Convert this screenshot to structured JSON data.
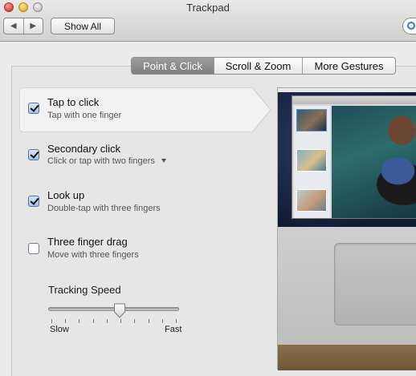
{
  "window": {
    "title": "Trackpad"
  },
  "toolbar": {
    "show_all_label": "Show All",
    "back_glyph": "◀",
    "forward_glyph": "▶"
  },
  "tabs": [
    {
      "label": "Point & Click",
      "active": true
    },
    {
      "label": "Scroll & Zoom",
      "active": false
    },
    {
      "label": "More Gestures",
      "active": false
    }
  ],
  "options": [
    {
      "label": "Tap to click",
      "sublabel": "Tap with one finger",
      "checked": true,
      "selected": true
    },
    {
      "label": "Secondary click",
      "sublabel": "Click or tap with two fingers",
      "checked": true,
      "has_dropdown": true
    },
    {
      "label": "Look up",
      "sublabel": "Double-tap with three fingers",
      "checked": true
    },
    {
      "label": "Three finger drag",
      "sublabel": "Move with three fingers",
      "checked": false
    }
  ],
  "tracking_speed": {
    "label": "Tracking Speed",
    "min_label": "Slow",
    "max_label": "Fast",
    "value_fraction": 0.55,
    "tick_count": 10
  },
  "colors": {
    "active_tab": "#8a8a8a",
    "checkbox_check": "#a6c2e6",
    "search_ring": "#3b77c9"
  },
  "icons": {
    "search": "magnifier-icon",
    "back": "chevron-left-icon",
    "forward": "chevron-right-icon"
  }
}
